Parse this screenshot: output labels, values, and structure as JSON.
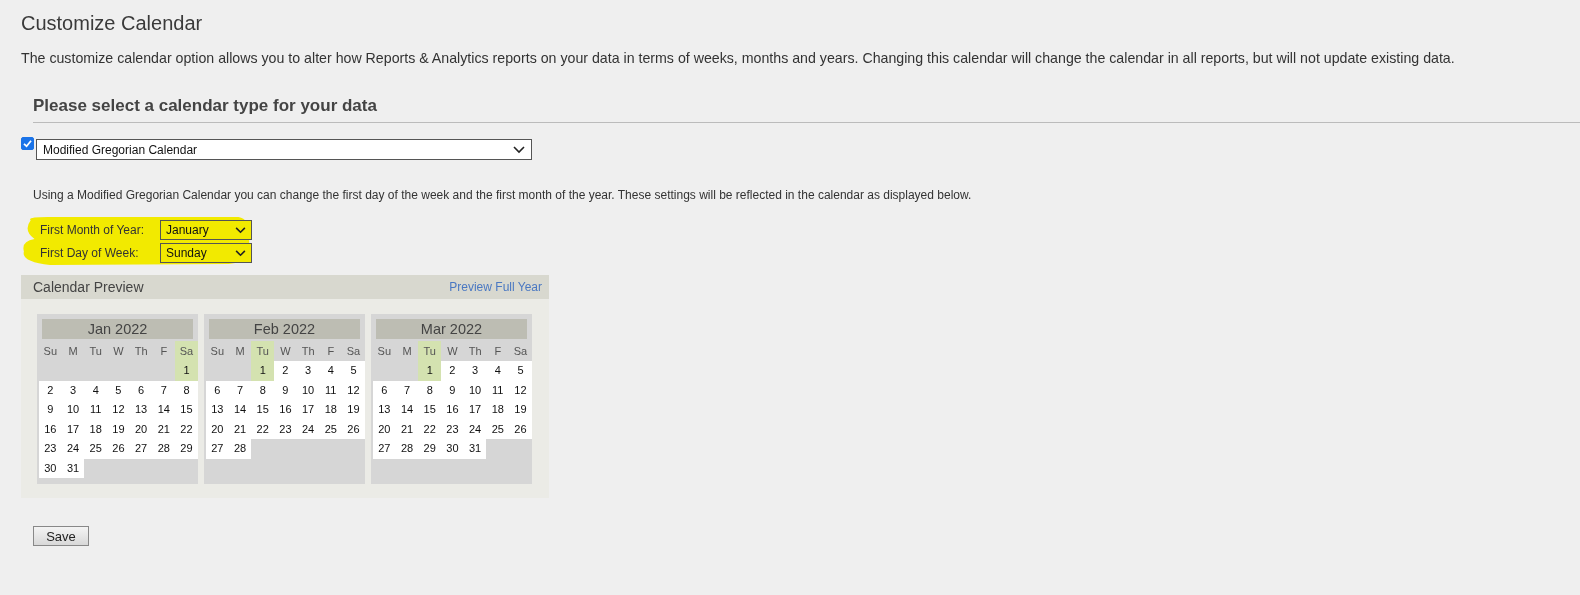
{
  "page_title": "Customize Calendar",
  "description": "The customize calendar option allows you to alter how Reports & Analytics reports on your data in terms of weeks, months and years. Changing this calendar will change the calendar in all reports, but will not update existing data.",
  "section_heading": "Please select a calendar type for your data",
  "calendar_type": {
    "checked": true,
    "value": "Modified Gregorian Calendar"
  },
  "note": "Using a Modified Gregorian Calendar you can change the first day of the week and the first month of the year. These settings will be reflected in the calendar as displayed below.",
  "settings": [
    {
      "label": "First Month of Year:",
      "value": "January",
      "highlighted": true
    },
    {
      "label": "First Day of Week:",
      "value": "Sunday",
      "highlighted": true
    }
  ],
  "preview": {
    "title": "Calendar Preview",
    "link": "Preview Full Year",
    "months": [
      {
        "name": "Jan 2022",
        "weekdays": [
          {
            "label": "Su",
            "highlighted": false
          },
          {
            "label": "M",
            "highlighted": false
          },
          {
            "label": "Tu",
            "highlighted": false
          },
          {
            "label": "W",
            "highlighted": false
          },
          {
            "label": "Th",
            "highlighted": false
          },
          {
            "label": "F",
            "highlighted": false
          },
          {
            "label": "Sa",
            "highlighted": true
          }
        ],
        "days": [
          {
            "text": "1",
            "highlighted": true
          },
          {
            "text": "2",
            "highlighted": false
          },
          {
            "text": "3",
            "highlighted": false
          },
          {
            "text": "4",
            "highlighted": false
          },
          {
            "text": "5",
            "highlighted": false
          },
          {
            "text": "6",
            "highlighted": false
          },
          {
            "text": "7",
            "highlighted": false
          },
          {
            "text": "8",
            "highlighted": false
          },
          {
            "text": "9",
            "highlighted": false
          },
          {
            "text": "10",
            "highlighted": false
          },
          {
            "text": "11",
            "highlighted": false
          },
          {
            "text": "12",
            "highlighted": false
          },
          {
            "text": "13",
            "highlighted": false
          },
          {
            "text": "14",
            "highlighted": false
          },
          {
            "text": "15",
            "highlighted": false
          },
          {
            "text": "16",
            "highlighted": false
          },
          {
            "text": "17",
            "highlighted": false
          },
          {
            "text": "18",
            "highlighted": false
          },
          {
            "text": "19",
            "highlighted": false
          },
          {
            "text": "20",
            "highlighted": false
          },
          {
            "text": "21",
            "highlighted": false
          },
          {
            "text": "22",
            "highlighted": false
          },
          {
            "text": "23",
            "highlighted": false
          },
          {
            "text": "24",
            "highlighted": false
          },
          {
            "text": "25",
            "highlighted": false
          },
          {
            "text": "26",
            "highlighted": false
          },
          {
            "text": "27",
            "highlighted": false
          },
          {
            "text": "28",
            "highlighted": false
          },
          {
            "text": "29",
            "highlighted": false
          },
          {
            "text": "30",
            "highlighted": false
          },
          {
            "text": "31",
            "highlighted": false
          }
        ]
      },
      {
        "name": "Feb 2022",
        "weekdays": [
          {
            "label": "Su",
            "highlighted": false
          },
          {
            "label": "M",
            "highlighted": false
          },
          {
            "label": "Tu",
            "highlighted": true
          },
          {
            "label": "W",
            "highlighted": false
          },
          {
            "label": "Th",
            "highlighted": false
          },
          {
            "label": "F",
            "highlighted": false
          },
          {
            "label": "Sa",
            "highlighted": false
          }
        ],
        "days": [
          {
            "text": "1",
            "highlighted": true
          },
          {
            "text": "2",
            "highlighted": false
          },
          {
            "text": "3",
            "highlighted": false
          },
          {
            "text": "4",
            "highlighted": false
          },
          {
            "text": "5",
            "highlighted": false
          },
          {
            "text": "6",
            "highlighted": false
          },
          {
            "text": "7",
            "highlighted": false
          },
          {
            "text": "8",
            "highlighted": false
          },
          {
            "text": "9",
            "highlighted": false
          },
          {
            "text": "10",
            "highlighted": false
          },
          {
            "text": "11",
            "highlighted": false
          },
          {
            "text": "12",
            "highlighted": false
          },
          {
            "text": "13",
            "highlighted": false
          },
          {
            "text": "14",
            "highlighted": false
          },
          {
            "text": "15",
            "highlighted": false
          },
          {
            "text": "16",
            "highlighted": false
          },
          {
            "text": "17",
            "highlighted": false
          },
          {
            "text": "18",
            "highlighted": false
          },
          {
            "text": "19",
            "highlighted": false
          },
          {
            "text": "20",
            "highlighted": false
          },
          {
            "text": "21",
            "highlighted": false
          },
          {
            "text": "22",
            "highlighted": false
          },
          {
            "text": "23",
            "highlighted": false
          },
          {
            "text": "24",
            "highlighted": false
          },
          {
            "text": "25",
            "highlighted": false
          },
          {
            "text": "26",
            "highlighted": false
          },
          {
            "text": "27",
            "highlighted": false
          },
          {
            "text": "28",
            "highlighted": false
          }
        ]
      },
      {
        "name": "Mar 2022",
        "weekdays": [
          {
            "label": "Su",
            "highlighted": false
          },
          {
            "label": "M",
            "highlighted": false
          },
          {
            "label": "Tu",
            "highlighted": true
          },
          {
            "label": "W",
            "highlighted": false
          },
          {
            "label": "Th",
            "highlighted": false
          },
          {
            "label": "F",
            "highlighted": false
          },
          {
            "label": "Sa",
            "highlighted": false
          }
        ],
        "days": [
          {
            "text": "1",
            "highlighted": true
          },
          {
            "text": "2",
            "highlighted": false
          },
          {
            "text": "3",
            "highlighted": false
          },
          {
            "text": "4",
            "highlighted": false
          },
          {
            "text": "5",
            "highlighted": false
          },
          {
            "text": "6",
            "highlighted": false
          },
          {
            "text": "7",
            "highlighted": false
          },
          {
            "text": "8",
            "highlighted": false
          },
          {
            "text": "9",
            "highlighted": false
          },
          {
            "text": "10",
            "highlighted": false
          },
          {
            "text": "11",
            "highlighted": false
          },
          {
            "text": "12",
            "highlighted": false
          },
          {
            "text": "13",
            "highlighted": false
          },
          {
            "text": "14",
            "highlighted": false
          },
          {
            "text": "15",
            "highlighted": false
          },
          {
            "text": "16",
            "highlighted": false
          },
          {
            "text": "17",
            "highlighted": false
          },
          {
            "text": "18",
            "highlighted": false
          },
          {
            "text": "19",
            "highlighted": false
          },
          {
            "text": "20",
            "highlighted": false
          },
          {
            "text": "21",
            "highlighted": false
          },
          {
            "text": "22",
            "highlighted": false
          },
          {
            "text": "23",
            "highlighted": false
          },
          {
            "text": "24",
            "highlighted": false
          },
          {
            "text": "25",
            "highlighted": false
          },
          {
            "text": "26",
            "highlighted": false
          },
          {
            "text": "27",
            "highlighted": false
          },
          {
            "text": "28",
            "highlighted": false
          },
          {
            "text": "29",
            "highlighted": false
          },
          {
            "text": "30",
            "highlighted": false
          },
          {
            "text": "31",
            "highlighted": false
          }
        ]
      }
    ]
  },
  "save_button": "Save"
}
